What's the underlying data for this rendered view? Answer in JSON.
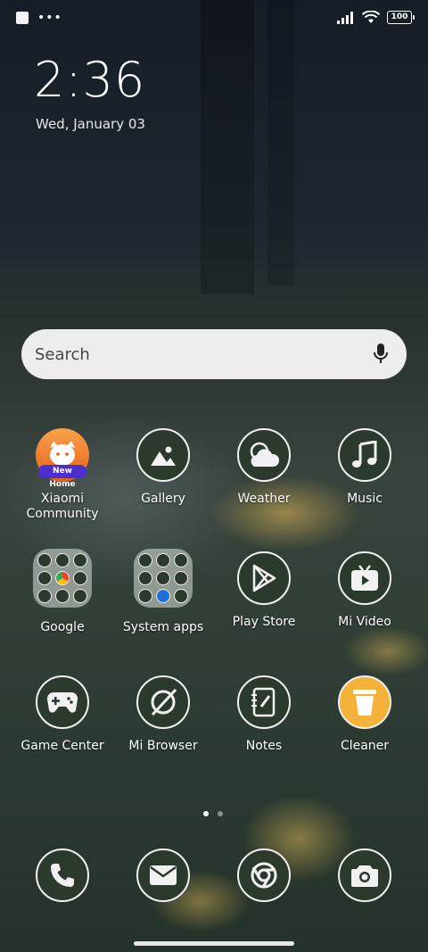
{
  "status_bar": {
    "battery": "100"
  },
  "clock": {
    "time": "2:36",
    "date": "Wed, January 03"
  },
  "search": {
    "placeholder": "Search"
  },
  "apps": [
    {
      "label": "Xiaomi\nCommunity",
      "badge": "New Home"
    },
    {
      "label": "Gallery"
    },
    {
      "label": "Weather"
    },
    {
      "label": "Music"
    },
    {
      "label": "Google"
    },
    {
      "label": "System apps"
    },
    {
      "label": "Play Store"
    },
    {
      "label": "Mi Video"
    },
    {
      "label": "Game Center"
    },
    {
      "label": "Mi Browser"
    },
    {
      "label": "Notes"
    },
    {
      "label": "Cleaner"
    }
  ],
  "dock": [
    "phone-icon",
    "messages-icon",
    "chrome-icon",
    "camera-icon"
  ],
  "colors": {
    "icon_bg": "#2b3a2c",
    "icon_stroke": "#f1f1f1",
    "cleaner": "#f5b23a",
    "community": "#f47a1f"
  }
}
